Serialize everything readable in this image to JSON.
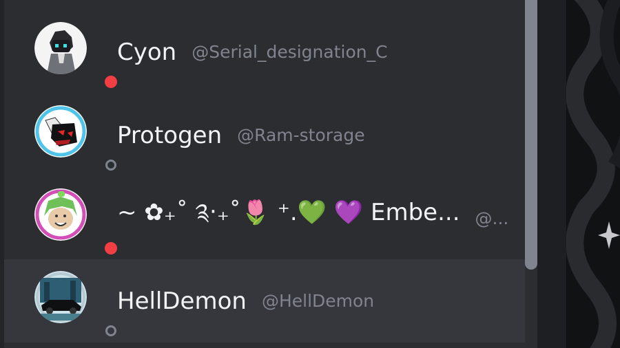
{
  "members": [
    {
      "display_name": "Cyon",
      "handle": "@Serial_designation_C",
      "status": "dnd"
    },
    {
      "display_name": "Protogen",
      "handle": "@Ram-storage",
      "status": "offline"
    },
    {
      "display_name": "~ ✿₊˚ ༉‧₊˚🌷 ⁺.💚 💜 Embe...",
      "handle": "@...",
      "status": "dnd"
    },
    {
      "display_name": "HellDemon",
      "handle": "@HellDemon",
      "status": "offline"
    }
  ],
  "colors": {
    "panel": "#2b2d31",
    "hover_row": "#36373d",
    "dnd": "#f23f43",
    "offline": "#80848e"
  }
}
